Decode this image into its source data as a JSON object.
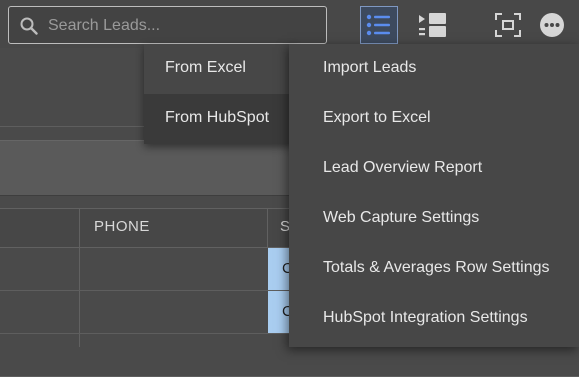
{
  "search": {
    "placeholder": "Search Leads..."
  },
  "toolbar": {
    "icons": [
      "list-view-icon",
      "split-view-icon",
      "expand-icon",
      "more-options-icon"
    ],
    "accent": "#5b8def"
  },
  "table": {
    "headers": {
      "phone": "PHONE",
      "status_partial": "S"
    },
    "rows": [
      {
        "status_partial": "C"
      },
      {
        "status_partial": "C"
      }
    ],
    "status_color": "#a9cdf0"
  },
  "import_submenu": {
    "items": [
      {
        "label": "From Excel"
      },
      {
        "label": "From HubSpot"
      }
    ]
  },
  "more_menu": {
    "items": [
      {
        "label": "Import Leads"
      },
      {
        "label": "Export to Excel"
      },
      {
        "label": "Lead Overview Report"
      },
      {
        "label": "Web Capture Settings"
      },
      {
        "label": "Totals & Averages Row Settings"
      },
      {
        "label": "HubSpot Integration Settings"
      }
    ]
  }
}
